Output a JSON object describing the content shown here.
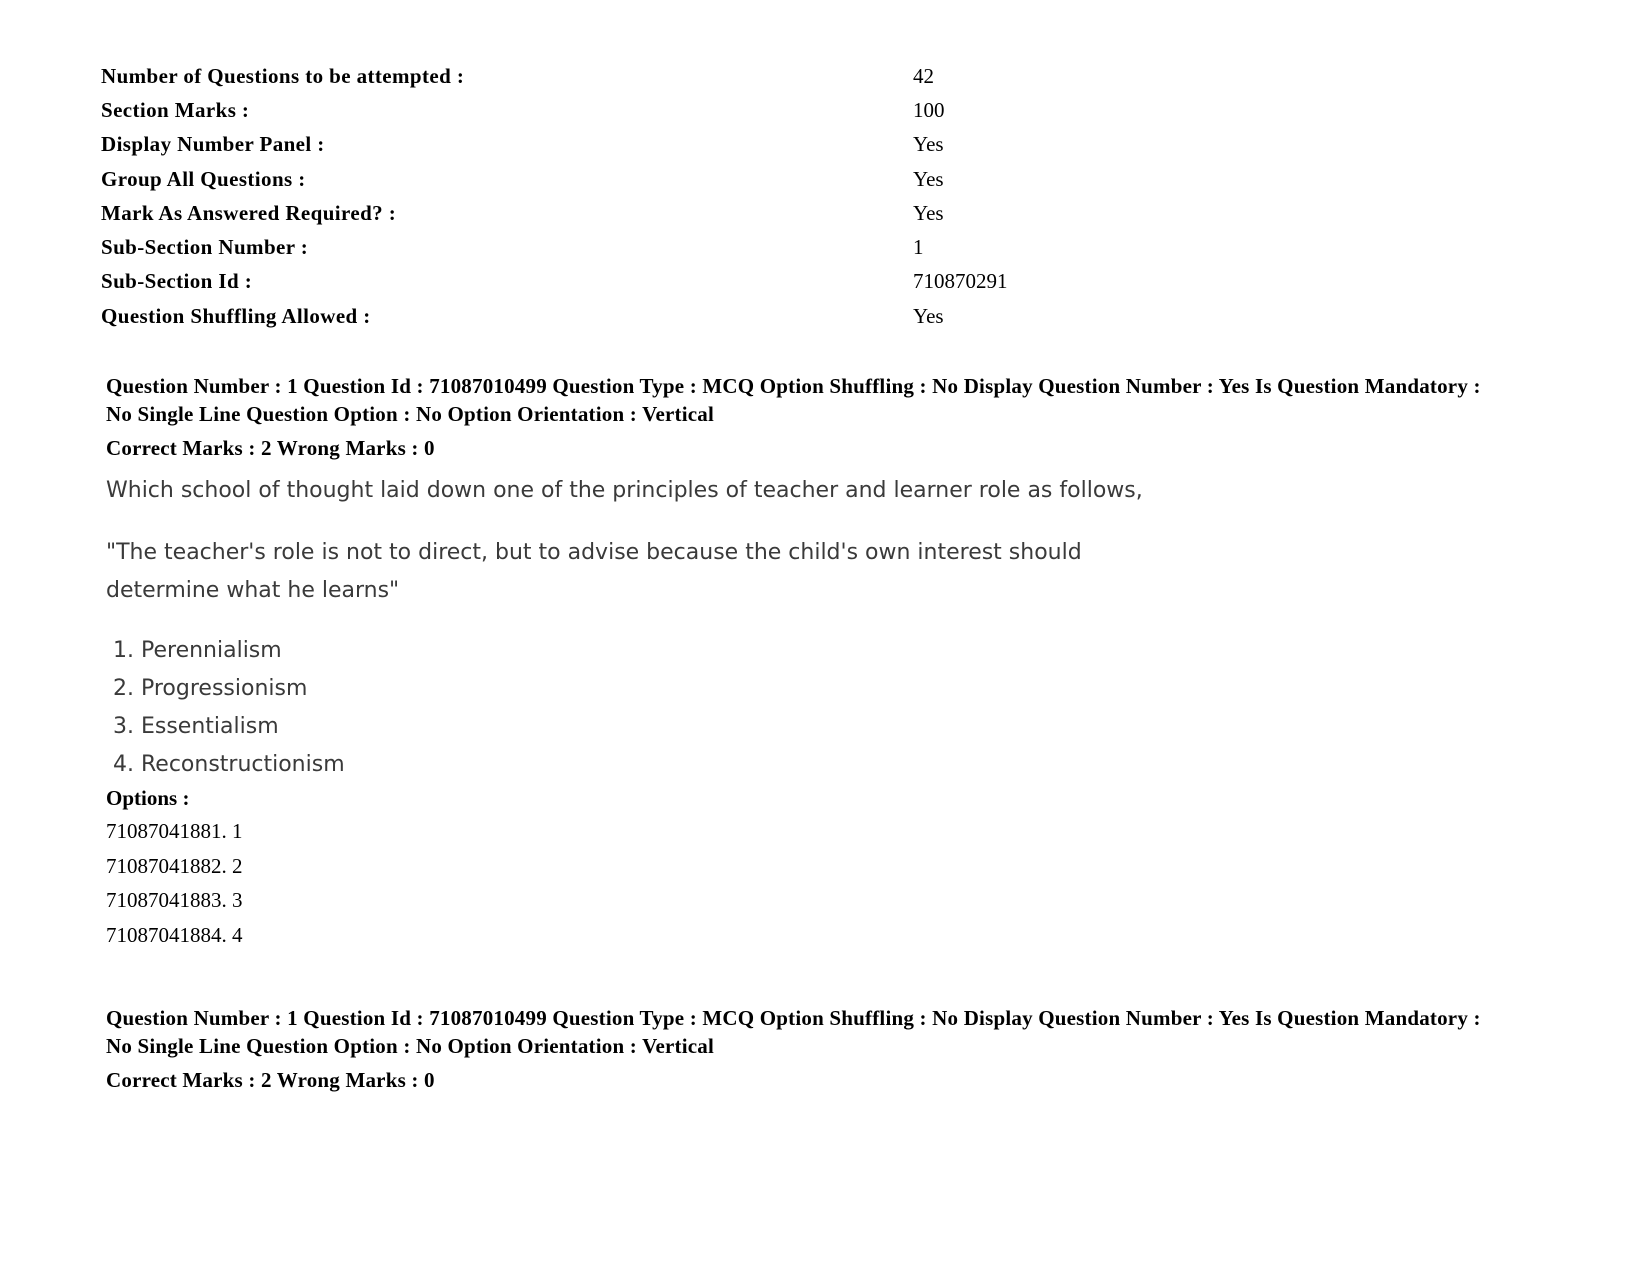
{
  "section_info": [
    {
      "label": "Number of Questions to be attempted :",
      "value": "42"
    },
    {
      "label": "Section Marks :",
      "value": "100"
    },
    {
      "label": "Display Number Panel :",
      "value": "Yes"
    },
    {
      "label": "Group All Questions :",
      "value": "Yes"
    },
    {
      "label": "Mark As Answered Required? :",
      "value": "Yes"
    },
    {
      "label": "Sub-Section Number :",
      "value": "1"
    },
    {
      "label": "Sub-Section Id :",
      "value": "710870291"
    },
    {
      "label": "Question Shuffling Allowed :",
      "value": "Yes"
    }
  ],
  "questions": [
    {
      "header": "Question Number : 1 Question Id : 71087010499 Question Type : MCQ Option Shuffling : No Display Question Number : Yes Is Question Mandatory : No Single Line Question Option : No Option Orientation : Vertical",
      "marks": "Correct Marks : 2 Wrong Marks : 0",
      "stem": "Which school of thought laid down one of the principles of teacher and learner role as follows,",
      "quote": "\"The teacher's role is not to direct, but to advise because the child's own interest should determine what he learns\"",
      "choices": [
        "1. Perennialism",
        "2. Progressionism",
        "3. Essentialism",
        "4. Reconstructionism"
      ],
      "options_label": "Options :",
      "options": [
        "71087041881. 1",
        "71087041882. 2",
        "71087041883. 3",
        "71087041884. 4"
      ]
    },
    {
      "header": "Question Number : 1 Question Id : 71087010499 Question Type : MCQ Option Shuffling : No Display Question Number : Yes Is Question Mandatory : No Single Line Question Option : No Option Orientation : Vertical",
      "marks": "Correct Marks : 2 Wrong Marks : 0"
    }
  ]
}
